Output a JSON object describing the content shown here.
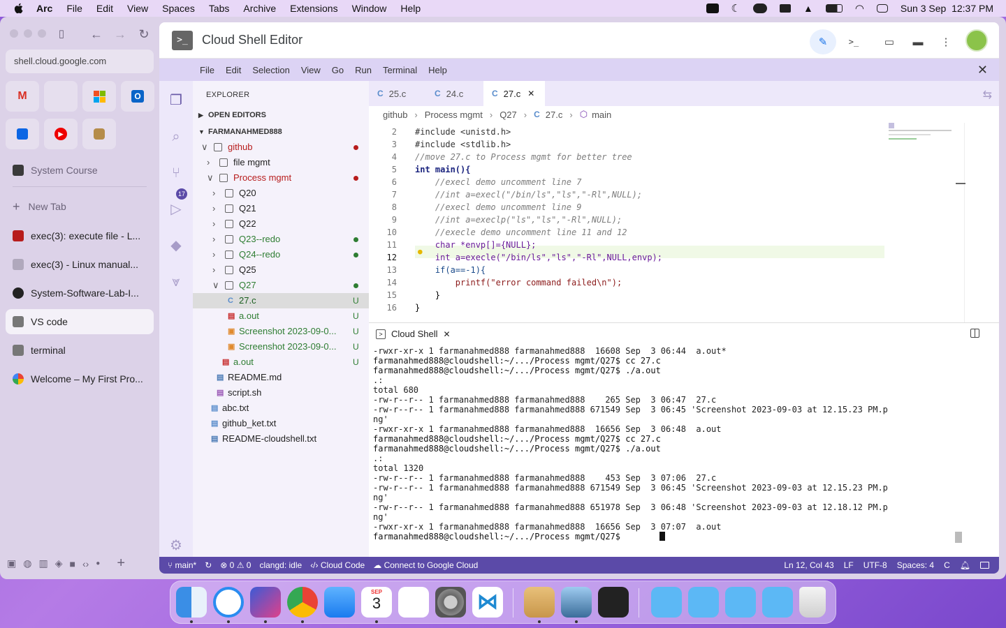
{
  "menubar": {
    "app": "Arc",
    "items": [
      "File",
      "Edit",
      "View",
      "Spaces",
      "Tabs",
      "Archive",
      "Extensions",
      "Window",
      "Help"
    ],
    "clock": "Sun 3 Sep  12:37 PM"
  },
  "browser": {
    "url": "shell.cloud.google.com",
    "pinned_folder": "System Course",
    "new_tab": "New Tab",
    "tabs": [
      {
        "label": "exec(3): execute file - L...",
        "color": "#b71c1c"
      },
      {
        "label": "exec(3) - Linux manual...",
        "color": "#9e9e9e"
      },
      {
        "label": "System-Software-Lab-I...",
        "color": "#222222"
      },
      {
        "label": "VS code",
        "color": "#777777"
      },
      {
        "label": "terminal",
        "color": "#777777"
      },
      {
        "label": "Welcome – My First Pro...",
        "color": "#4285f4"
      }
    ]
  },
  "cloudshell": {
    "title": "Cloud Shell Editor"
  },
  "vs_menu": [
    "File",
    "Edit",
    "Selection",
    "View",
    "Go",
    "Run",
    "Terminal",
    "Help"
  ],
  "activity": {
    "badge": "17"
  },
  "explorer": {
    "header": "EXPLORER",
    "open_editors": "OPEN EDITORS",
    "root": "FARMANAHMED888",
    "tree": [
      {
        "label": "github",
        "kind": "folder",
        "open": true,
        "color": "red",
        "mark": "dot-red"
      },
      {
        "label": "file mgmt",
        "kind": "folder",
        "open": false,
        "color": "",
        "mark": ""
      },
      {
        "label": "Process mgmt",
        "kind": "folder",
        "open": true,
        "color": "red",
        "mark": "dot-red"
      },
      {
        "label": "Q20",
        "kind": "folder",
        "open": false,
        "color": "",
        "mark": ""
      },
      {
        "label": "Q21",
        "kind": "folder",
        "open": false,
        "color": "",
        "mark": ""
      },
      {
        "label": "Q22",
        "kind": "folder",
        "open": false,
        "color": "",
        "mark": ""
      },
      {
        "label": "Q23--redo",
        "kind": "folder",
        "open": false,
        "color": "green",
        "mark": "dot-green"
      },
      {
        "label": "Q24--redo",
        "kind": "folder",
        "open": false,
        "color": "green",
        "mark": "dot-green"
      },
      {
        "label": "Q25",
        "kind": "folder",
        "open": false,
        "color": "",
        "mark": ""
      },
      {
        "label": "Q27",
        "kind": "folder",
        "open": true,
        "color": "green",
        "mark": "dot-green"
      },
      {
        "label": "27.c",
        "kind": "c",
        "color": "green",
        "mark": "U",
        "selected": true
      },
      {
        "label": "a.out",
        "kind": "bin",
        "color": "green",
        "mark": "U"
      },
      {
        "label": "Screenshot 2023-09-0...",
        "kind": "img",
        "color": "green",
        "mark": "U"
      },
      {
        "label": "Screenshot 2023-09-0...",
        "kind": "img",
        "color": "green",
        "mark": "U"
      },
      {
        "label": "a.out",
        "kind": "bin",
        "color": "green",
        "mark": "U"
      },
      {
        "label": "README.md",
        "kind": "md",
        "color": "",
        "mark": ""
      },
      {
        "label": "script.sh",
        "kind": "sh",
        "color": "",
        "mark": ""
      },
      {
        "label": "abc.txt",
        "kind": "txt",
        "color": "",
        "mark": ""
      },
      {
        "label": "github_ket.txt",
        "kind": "txt",
        "color": "",
        "mark": ""
      },
      {
        "label": "README-cloudshell.txt",
        "kind": "md",
        "color": "",
        "mark": ""
      }
    ]
  },
  "editor": {
    "tabs": [
      "25.c",
      "24.c",
      "27.c"
    ],
    "active_tab": "27.c",
    "breadcrumb": [
      "github",
      "Process mgmt",
      "Q27",
      "27.c",
      "main"
    ],
    "lines": [
      {
        "n": "2",
        "text": "#include <unistd.h>"
      },
      {
        "n": "3",
        "text": "#include <stdlib.h>"
      },
      {
        "n": "4",
        "text": "//move 27.c to Process mgmt for better tree"
      },
      {
        "n": "5",
        "text": "int main(){"
      },
      {
        "n": "6",
        "text": "    //execl demo uncomment line 7"
      },
      {
        "n": "7",
        "text": "    //int a=execl(\"/bin/ls\",\"ls\",\"-Rl\",NULL);"
      },
      {
        "n": "8",
        "text": "    //execl demo uncomment line 9"
      },
      {
        "n": "9",
        "text": "    //int a=execlp(\"ls\",\"ls\",\"-Rl\",NULL);"
      },
      {
        "n": "10",
        "text": "    //execle demo uncomment line 11 and 12"
      },
      {
        "n": "11",
        "text": "    char *envp[]={NULL};"
      },
      {
        "n": "12",
        "text": "    int a=execle(\"/bin/ls\",\"ls\",\"-Rl\",NULL,envp);"
      },
      {
        "n": "13",
        "text": "    if(a==-1){"
      },
      {
        "n": "14",
        "text": "        printf(\"error command failed\\n\");"
      },
      {
        "n": "15",
        "text": "    }"
      },
      {
        "n": "16",
        "text": "}"
      }
    ]
  },
  "terminal": {
    "title": "Cloud Shell",
    "lines": [
      "-rwxr-xr-x 1 farmanahmed888 farmanahmed888  16608 Sep  3 06:44  a.out*",
      "farmanahmed888@cloudshell:~/.../Process mgmt/Q27$ cc 27.c",
      "farmanahmed888@cloudshell:~/.../Process mgmt/Q27$ ./a.out",
      ".:",
      "total 680",
      "-rw-r--r-- 1 farmanahmed888 farmanahmed888    265 Sep  3 06:47  27.c",
      "-rw-r--r-- 1 farmanahmed888 farmanahmed888 671549 Sep  3 06:45 'Screenshot 2023-09-03 at 12.15.23 PM.p",
      "ng'",
      "-rwxr-xr-x 1 farmanahmed888 farmanahmed888  16656 Sep  3 06:48  a.out",
      "farmanahmed888@cloudshell:~/.../Process mgmt/Q27$ cc 27.c",
      "farmanahmed888@cloudshell:~/.../Process mgmt/Q27$ ./a.out",
      ".:",
      "total 1320",
      "-rw-r--r-- 1 farmanahmed888 farmanahmed888    453 Sep  3 07:06  27.c",
      "-rw-r--r-- 1 farmanahmed888 farmanahmed888 671549 Sep  3 06:45 'Screenshot 2023-09-03 at 12.15.23 PM.p",
      "ng'",
      "-rw-r--r-- 1 farmanahmed888 farmanahmed888 651978 Sep  3 06:48 'Screenshot 2023-09-03 at 12.18.12 PM.p",
      "ng'",
      "-rwxr-xr-x 1 farmanahmed888 farmanahmed888  16656 Sep  3 07:07  a.out",
      "farmanahmed888@cloudshell:~/.../Process mgmt/Q27$ "
    ]
  },
  "status": {
    "branch": "main*",
    "problems": "⊗ 0 ⚠ 0",
    "clangd": "clangd: idle",
    "cloud_code": "Cloud Code",
    "connect": "Connect to Google Cloud",
    "position": "Ln 12, Col 43",
    "eol": "LF",
    "encoding": "UTF-8",
    "spaces": "Spaces: 4",
    "lang": "C"
  },
  "dock": {
    "calendar_month": "SEP",
    "calendar_day": "3",
    "apps": [
      "finder",
      "safari",
      "affinity",
      "chrome",
      "mail",
      "calendar",
      "reminders",
      "system-settings",
      "vscode",
      "archive",
      "preview",
      "zoom-like",
      "app-store-folder",
      "folder",
      "folder",
      "downloads-folder",
      "trash"
    ]
  },
  "colors": {
    "accent": "#5b4aa8",
    "menubar_bg": "#dcd3f4",
    "git_red": "#b71c1c",
    "git_green": "#2e7d32"
  }
}
